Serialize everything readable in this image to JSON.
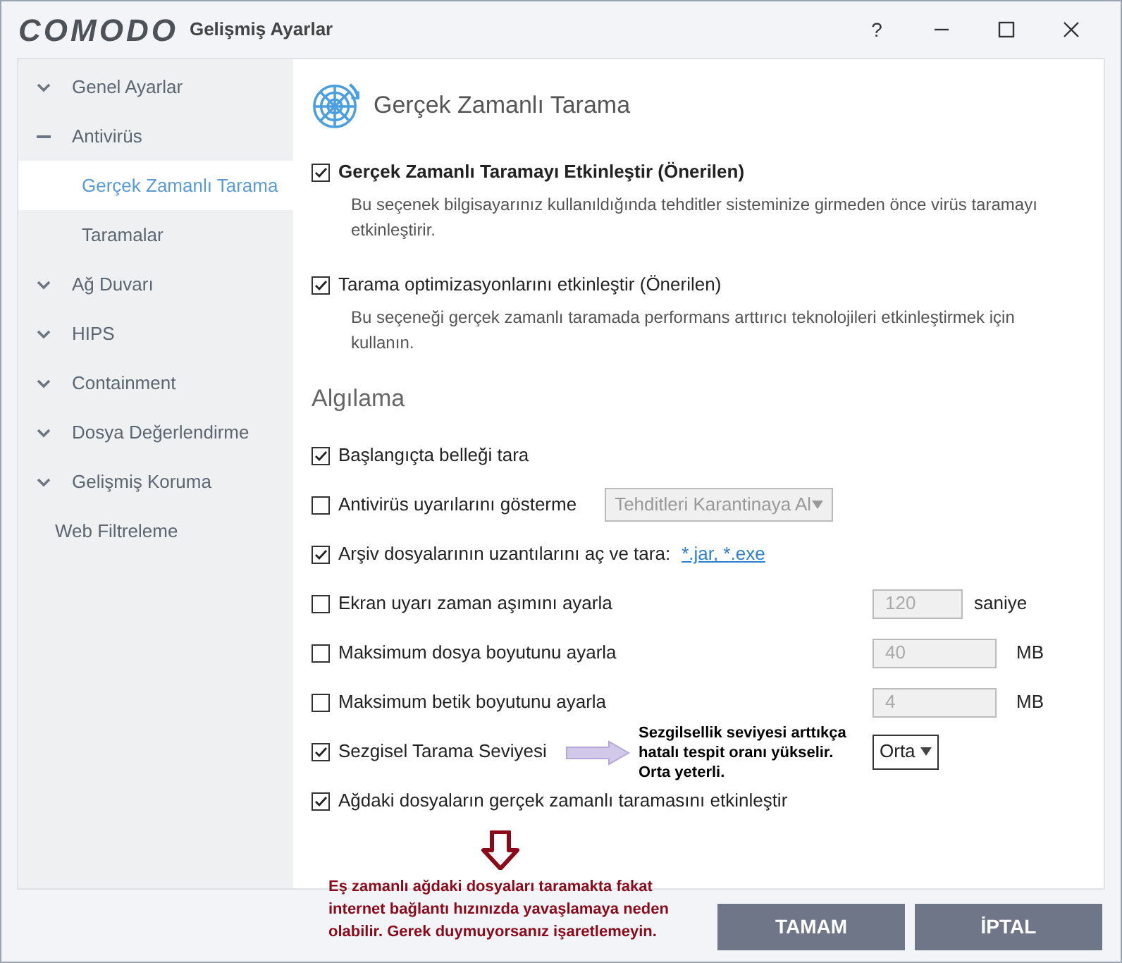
{
  "window": {
    "logo": "COMODO",
    "title": "Gelişmiş Ayarlar",
    "help": "?"
  },
  "sidebar": {
    "items": [
      {
        "label": "Genel Ayarlar",
        "kind": "collapsed",
        "selected": false
      },
      {
        "label": "Antivirüs",
        "kind": "expanded",
        "selected": false
      },
      {
        "label": "Gerçek Zamanlı Tarama",
        "kind": "child",
        "selected": true
      },
      {
        "label": "Taramalar",
        "kind": "child",
        "selected": false
      },
      {
        "label": "Ağ Duvarı",
        "kind": "collapsed",
        "selected": false
      },
      {
        "label": "HIPS",
        "kind": "collapsed",
        "selected": false
      },
      {
        "label": "Containment",
        "kind": "collapsed",
        "selected": false
      },
      {
        "label": "Dosya Değerlendirme",
        "kind": "collapsed",
        "selected": false
      },
      {
        "label": "Gelişmiş Koruma",
        "kind": "collapsed",
        "selected": false
      },
      {
        "label": "Web Filtreleme",
        "kind": "plain",
        "selected": false
      }
    ]
  },
  "page": {
    "title": "Gerçek Zamanlı Tarama",
    "options": [
      {
        "label": "Gerçek Zamanlı Taramayı Etkinleştir (Önerilen)",
        "checked": true,
        "bold": true,
        "description": "Bu seçenek bilgisayarınız kullanıldığında tehditler sisteminize girmeden önce virüs taramayı etkinleştirir."
      },
      {
        "label": "Tarama optimizasyonlarını etkinleştir (Önerilen)",
        "checked": true,
        "bold": false,
        "description": "Bu seçeneği gerçek zamanlı taramada performans arttırıcı teknolojileri etkinleştirmek için kullanın."
      }
    ],
    "section": "Algılama",
    "settings": [
      {
        "label": "Başlangıçta belleği tara",
        "checked": true,
        "kind": "plain"
      },
      {
        "label": "Antivirüs uyarılarını gösterme",
        "checked": false,
        "kind": "dropdown",
        "value": "Tehditleri Karantinaya Al",
        "disabled": true
      },
      {
        "label": "Arşiv dosyalarının uzantılarını aç ve tara:",
        "checked": true,
        "kind": "link",
        "link": "*.jar, *.exe"
      },
      {
        "label": "Ekran uyarı zaman aşımını ayarla",
        "checked": false,
        "kind": "number",
        "value": "120",
        "unit": "saniye",
        "disabled": true
      },
      {
        "label": "Maksimum dosya boyutunu ayarla",
        "checked": false,
        "kind": "number",
        "value": "40",
        "unit": "MB",
        "disabled": true
      },
      {
        "label": "Maksimum betik boyutunu ayarla",
        "checked": false,
        "kind": "number",
        "value": "4",
        "unit": "MB",
        "disabled": true
      },
      {
        "label": "Sezgisel Tarama Seviyesi",
        "checked": true,
        "kind": "select",
        "value": "Orta",
        "disabled": false
      },
      {
        "label": "Ağdaki dosyaların gerçek zamanlı taramasını etkinleştir",
        "checked": true,
        "kind": "plain"
      }
    ]
  },
  "annotations": [
    {
      "kind": "right",
      "text": "Sezgilsellik seviyesi arttıkça hatalı tespit oranı yükselir. Orta yeterli.",
      "color": "#000000"
    },
    {
      "kind": "down",
      "text": "Eş zamanlı ağdaki dosyaları taramakta fakat internet bağlantı hızınızda yavaşlamaya neden olabilir. Gerek duymuyorsanız işaretlemeyin.",
      "color": "#8b0a1a"
    }
  ],
  "buttons": [
    "TAMAM",
    "İPTAL"
  ]
}
